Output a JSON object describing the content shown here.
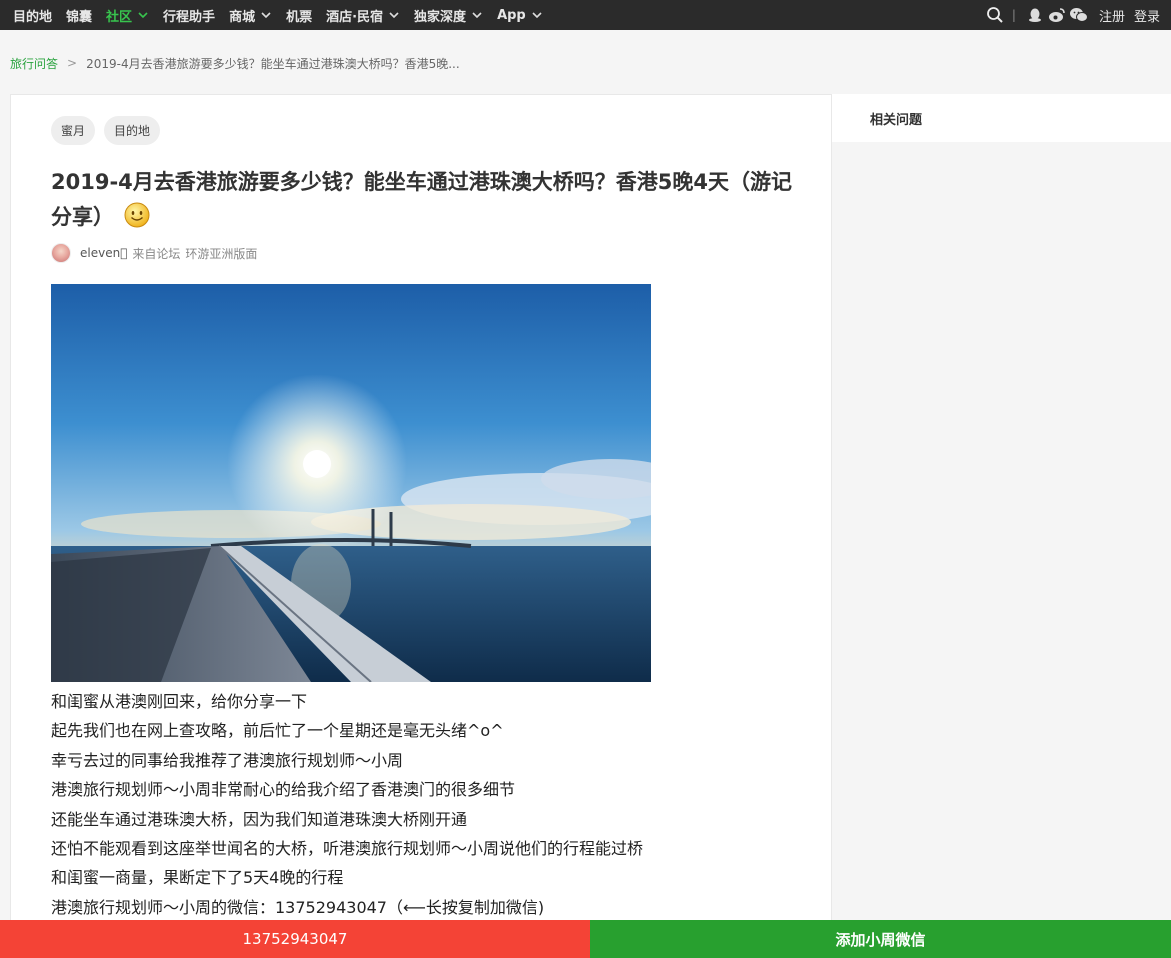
{
  "nav": {
    "items": [
      {
        "label": "目的地",
        "dropdown": false,
        "active": false
      },
      {
        "label": "锦囊",
        "dropdown": false,
        "active": false
      },
      {
        "label": "社区",
        "dropdown": true,
        "active": true
      },
      {
        "label": "行程助手",
        "dropdown": false,
        "active": false
      },
      {
        "label": "商城",
        "dropdown": true,
        "active": false
      },
      {
        "label": "机票",
        "dropdown": false,
        "active": false
      },
      {
        "label": "酒店·民宿",
        "dropdown": true,
        "active": false
      },
      {
        "label": "独家深度",
        "dropdown": true,
        "active": false
      },
      {
        "label": "App",
        "dropdown": true,
        "active": false
      }
    ],
    "separator": "|",
    "register_label": "注册",
    "login_label": "登录",
    "icons": [
      "search-icon",
      "qq-icon",
      "weibo-icon",
      "wechat-icon"
    ]
  },
  "breadcrumb": {
    "home": "旅行问答",
    "separator": ">",
    "current": "2019-4月去香港旅游要多少钱？能坐车通过港珠澳大桥吗？香港5晚..."
  },
  "post": {
    "tags": [
      "蜜月",
      "目的地"
    ],
    "title": "2019-4月去香港旅游要多少钱？能坐车通过港珠澳大桥吗？香港5晚4天（游记分享）",
    "author": {
      "name": "eleven\u0000",
      "from_text": "来自论坛",
      "forum": "环游亚洲版面"
    },
    "body": [
      "和闺蜜从港澳刚回来，给你分享一下",
      "起先我们也在网上查攻略，前后忙了一个星期还是毫无头绪^o^",
      "幸亏去过的同事给我推荐了港澳旅行规划师～小周",
      "港澳旅行规划师～小周非常耐心的给我介绍了香港澳门的很多细节",
      "还能坐车通过港珠澳大桥，因为我们知道港珠澳大桥刚开通",
      "还怕不能观看到这座举世闻名的大桥，听港澳旅行规划师～小周说他们的行程能过桥",
      "和闺蜜一商量，果断定下了5天4晚的行程",
      "港澳旅行规划师～小周的微信：13752943047（⟵长按复制加微信)"
    ]
  },
  "sidebar": {
    "title": "相关问题"
  },
  "bottom_bar": {
    "phone_label": "13752943047",
    "wechat_label": "添加小周微信"
  },
  "colors": {
    "nav_bg": "#2b2b2b",
    "accent_green": "#2aa33f",
    "call_red": "#f44336",
    "wechat_green": "#28a02f"
  }
}
